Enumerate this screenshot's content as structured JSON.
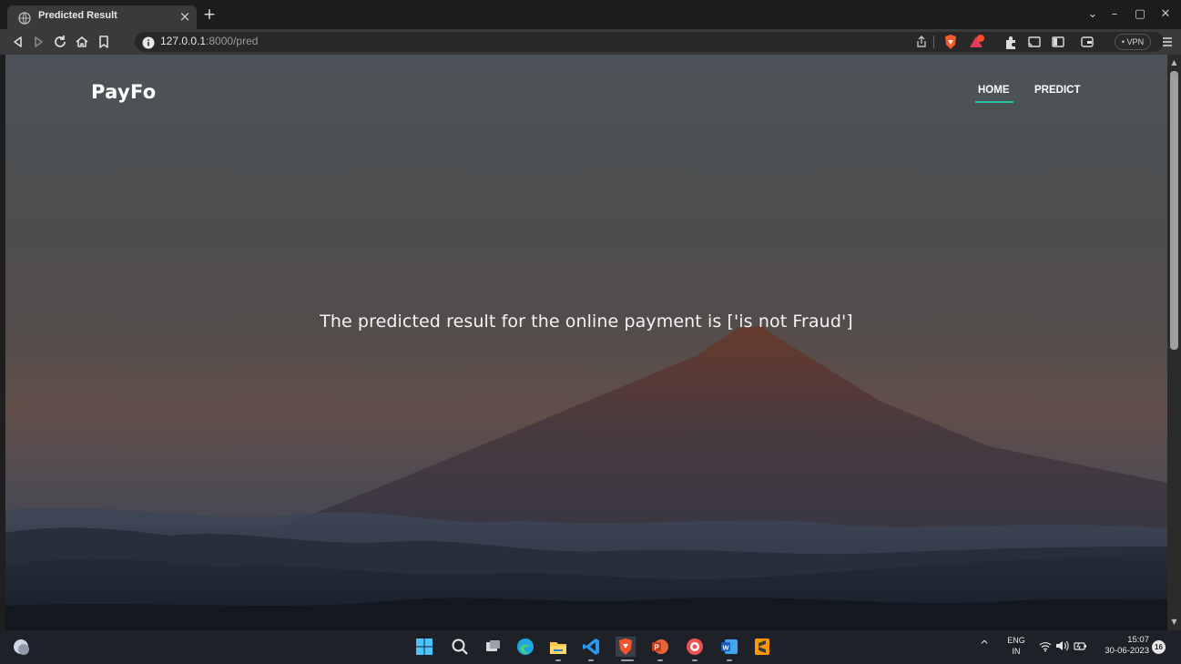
{
  "browser": {
    "tab_title": "Predicted Result",
    "tab_close": "×",
    "new_tab": "+",
    "url_host": "127.0.0.1",
    "url_rest": ":8000/pred",
    "vpn_label": "• VPN",
    "window_controls": {
      "minimize": "–",
      "maximize": "▢",
      "close": "✕",
      "tab_search": "⌄"
    }
  },
  "page": {
    "brand": "PayFo",
    "nav": [
      {
        "label": "HOME",
        "active": true
      },
      {
        "label": "PREDICT",
        "active": false
      }
    ],
    "result_text": "The predicted result for the online payment is ['is not Fraud']",
    "accent_color": "#26c6a6"
  },
  "taskbar": {
    "tray_chevron": "^",
    "lang_line1": "ENG",
    "lang_line2": "IN",
    "time": "15:07",
    "date": "30-06-2023",
    "notification_count": "16",
    "apps": [
      "windows-start-icon",
      "search-icon",
      "task-view-icon",
      "edge-icon",
      "file-explorer-icon",
      "vscode-icon",
      "brave-icon",
      "powerpoint-icon",
      "app-icon",
      "word-icon",
      "sublime-icon"
    ]
  }
}
